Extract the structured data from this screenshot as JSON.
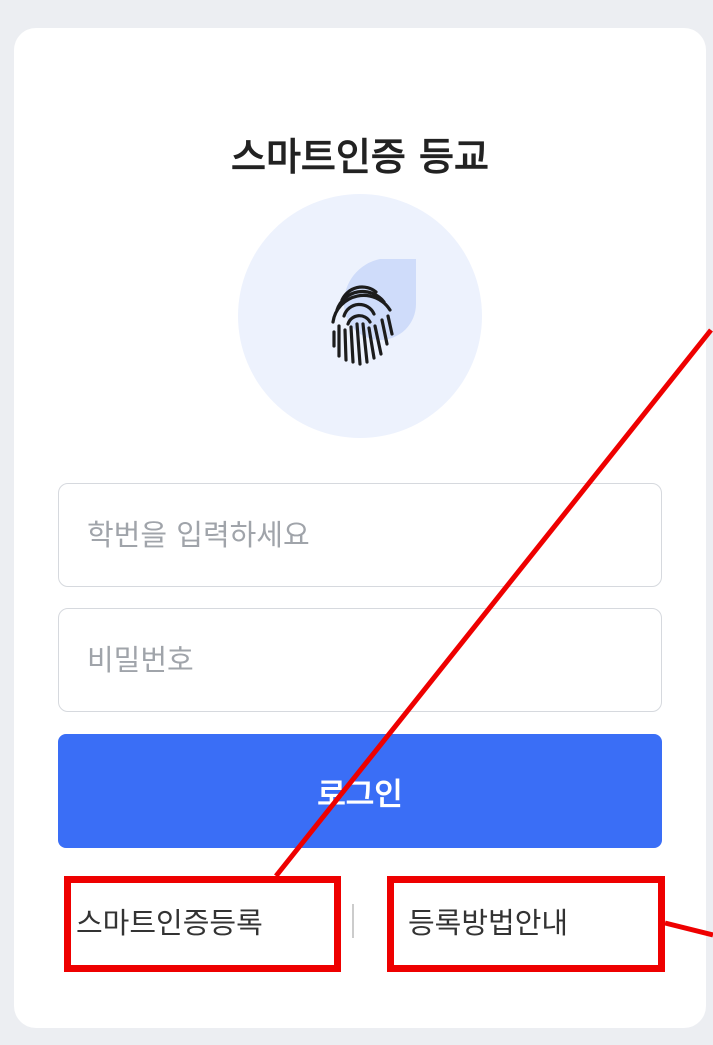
{
  "title": "스마트인증 등교",
  "hero": {
    "icon": "fingerprint-icon"
  },
  "form": {
    "student_id_placeholder": "학번을 입력하세요",
    "password_placeholder": "비밀번호",
    "login_label": "로그인"
  },
  "links": {
    "register": "스마트인증등록",
    "guide": "등록방법안내"
  },
  "colors": {
    "primary": "#3a6ef6",
    "icon_bg": "#edf2fd",
    "annotation": "#ee0000"
  }
}
